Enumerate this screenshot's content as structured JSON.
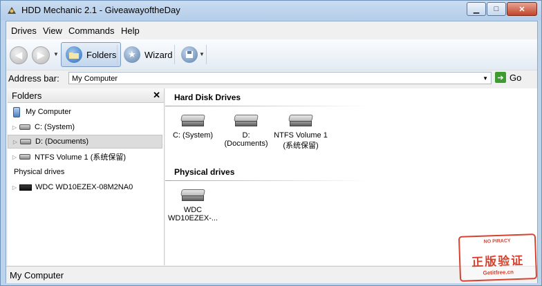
{
  "window": {
    "title": "HDD Mechanic 2.1 - GiveawayoftheDay",
    "min_glyph": "▁",
    "max_glyph": "□",
    "close_glyph": "✕"
  },
  "menu": {
    "items": [
      "Drives",
      "View",
      "Commands",
      "Help"
    ]
  },
  "toolbar": {
    "back_glyph": "◀",
    "forward_glyph": "▶",
    "dropdown_glyph": "▼",
    "folders_label": "Folders",
    "wizard_label": "Wizard"
  },
  "address": {
    "label": "Address bar:",
    "value": "My Computer",
    "go_label": "Go",
    "go_glyph": "➔"
  },
  "left_pane": {
    "title": "Folders",
    "close_glyph": "✕",
    "tree": {
      "root": "My Computer",
      "drives": [
        "C: (System)",
        "D: (Documents)",
        "NTFS Volume 1 (系统保留)"
      ],
      "physical_header": "Physical drives",
      "physical": [
        "WDC WD10EZEX-08M2NA0"
      ]
    }
  },
  "right_pane": {
    "groups": [
      {
        "title": "Hard Disk Drives",
        "items": [
          "C: (System)",
          "D:\n(Documents)",
          "NTFS Volume 1\n(系统保留)"
        ]
      },
      {
        "title": "Physical drives",
        "items": [
          "WDC\nWD10EZEX-..."
        ]
      }
    ]
  },
  "status": {
    "text": "My Computer"
  },
  "watermark": {
    "top": "NO PIRACY",
    "middle": "正版验证",
    "bottom": "Getitfree.cn"
  },
  "colors": {
    "title_gradient": "#c9dcf1",
    "close_red": "#c1452b",
    "go_green": "#3d9c2f",
    "stamp_red": "#d8412e"
  }
}
